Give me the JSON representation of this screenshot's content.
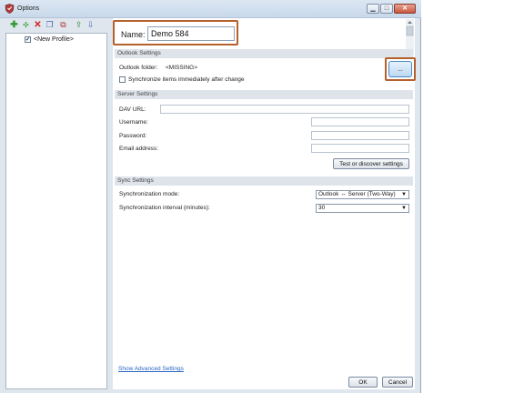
{
  "window": {
    "title": "Options",
    "controls": {
      "minimize": "▁",
      "maximize": "□",
      "close": "✕"
    }
  },
  "toolbar": {
    "icons": [
      "add-icon",
      "add-multiple-icon",
      "delete-icon",
      "copy-icon",
      "delete-copy-icon",
      "export-icon",
      "import-icon"
    ]
  },
  "tree": {
    "items": [
      {
        "label": "<New Profile>",
        "checked": true
      }
    ]
  },
  "profile": {
    "name_label": "Name:",
    "name_value": "Demo 584"
  },
  "outlook": {
    "section_title": "Outlook Settings",
    "folder_label": "Outlook folder:",
    "folder_value": "<MISSING>",
    "browse_label": "...",
    "sync_immediately_label": "Synchronize items immediately after change"
  },
  "server": {
    "section_title": "Server Settings",
    "dav_url_label": "DAV URL:",
    "username_label": "Username:",
    "password_label": "Password:",
    "email_label": "Email address:",
    "test_button": "Test or discover settings"
  },
  "sync": {
    "section_title": "Sync Settings",
    "mode_label": "Synchronization mode:",
    "mode_value": "Outlook ↔ Server (Two-Way)",
    "interval_label": "Synchronization interval (minutes):",
    "interval_value": "30"
  },
  "footer": {
    "advanced_link": "Show Advanced Settings",
    "ok_button": "OK",
    "cancel_button": "Cancel"
  }
}
